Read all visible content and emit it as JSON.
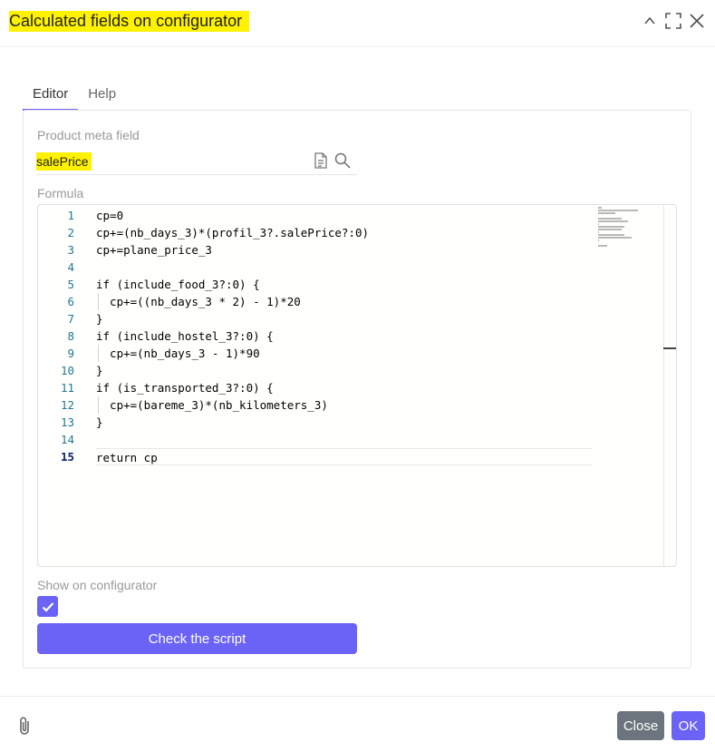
{
  "dialog": {
    "title": "Calculated fields on configurator",
    "controls": [
      "chevron-up-icon",
      "maximize-icon",
      "close-icon"
    ]
  },
  "tabs": [
    {
      "label": "Editor",
      "active": true
    },
    {
      "label": "Help",
      "active": false
    }
  ],
  "meta_field": {
    "label": "Product meta field",
    "value": "salePrice",
    "icons": [
      "document-icon",
      "search-icon"
    ]
  },
  "formula": {
    "label": "Formula",
    "lines": [
      {
        "n": "1",
        "text": "cp=0",
        "indent": false
      },
      {
        "n": "2",
        "text": "cp+=(nb_days_3)*(profil_3?.salePrice?:0)",
        "indent": false
      },
      {
        "n": "3",
        "text": "cp+=plane_price_3",
        "indent": false
      },
      {
        "n": "4",
        "text": "",
        "indent": false
      },
      {
        "n": "5",
        "text": "if (include_food_3?:0) {",
        "indent": false
      },
      {
        "n": "6",
        "text": "  cp+=((nb_days_3 * 2) - 1)*20",
        "indent": true
      },
      {
        "n": "7",
        "text": "}",
        "indent": false
      },
      {
        "n": "8",
        "text": "if (include_hostel_3?:0) {",
        "indent": false
      },
      {
        "n": "9",
        "text": "  cp+=(nb_days_3 - 1)*90",
        "indent": true
      },
      {
        "n": "10",
        "text": "}",
        "indent": false
      },
      {
        "n": "11",
        "text": "if (is_transported_3?:0) {",
        "indent": false
      },
      {
        "n": "12",
        "text": "  cp+=(bareme_3)*(nb_kilometers_3)",
        "indent": true
      },
      {
        "n": "13",
        "text": "}",
        "indent": false
      },
      {
        "n": "14",
        "text": "",
        "indent": false
      },
      {
        "n": "15",
        "text": "return cp",
        "indent": false
      }
    ],
    "current_line": "15"
  },
  "show_on_configurator": {
    "label": "Show on configurator",
    "checked": true
  },
  "check_button": {
    "label": "Check the script"
  },
  "footer": {
    "close_label": "Close",
    "ok_label": "OK"
  },
  "colors": {
    "accent": "#6b63f6",
    "highlight": "#fff200",
    "close_button": "#6c757d"
  }
}
